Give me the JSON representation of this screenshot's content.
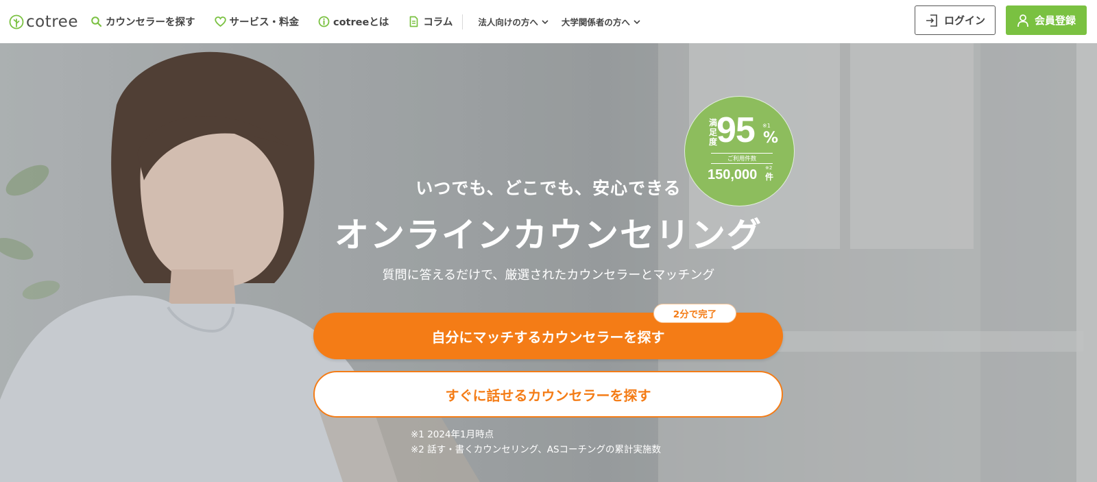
{
  "header": {
    "logo_text": "cotree",
    "nav": [
      {
        "label": "カウンセラーを探す",
        "icon": "search-icon"
      },
      {
        "label": "サービス・料金",
        "icon": "heart-icon"
      },
      {
        "label": "cotreeとは",
        "icon": "info-icon"
      },
      {
        "label": "コラム",
        "icon": "document-icon"
      }
    ],
    "dropdowns": [
      {
        "label": "法人向けの方へ",
        "icon": "chevron-down-icon"
      },
      {
        "label": "大学関係者の方へ",
        "icon": "chevron-down-icon"
      }
    ],
    "login_label": "ログイン",
    "register_label": "会員登録"
  },
  "hero": {
    "subheading": "いつでも、どこでも、安心できる",
    "title": "オンラインカウンセリング",
    "description": "質問に答えるだけで、厳選されたカウンセラーとマッチング",
    "badge": {
      "label": "満足度",
      "value": "95",
      "unit": "%",
      "note1": "※1",
      "sub_label": "ご利用件数",
      "count": "150,000",
      "count_unit": "件",
      "note2": "※2"
    },
    "primary_cta": "自分にマッチするカウンセラーを探す",
    "primary_tag": "2分で完了",
    "secondary_cta": "すぐに話せるカウンセラーを探す",
    "footnotes": [
      "※1 2024年1月時点",
      "※2 話す・書くカウンセリング、ASコーチングの累計実施数"
    ]
  },
  "colors": {
    "brand_green": "#7ac141",
    "badge_green": "#8dbd5d",
    "cta_orange": "#f47c16"
  }
}
